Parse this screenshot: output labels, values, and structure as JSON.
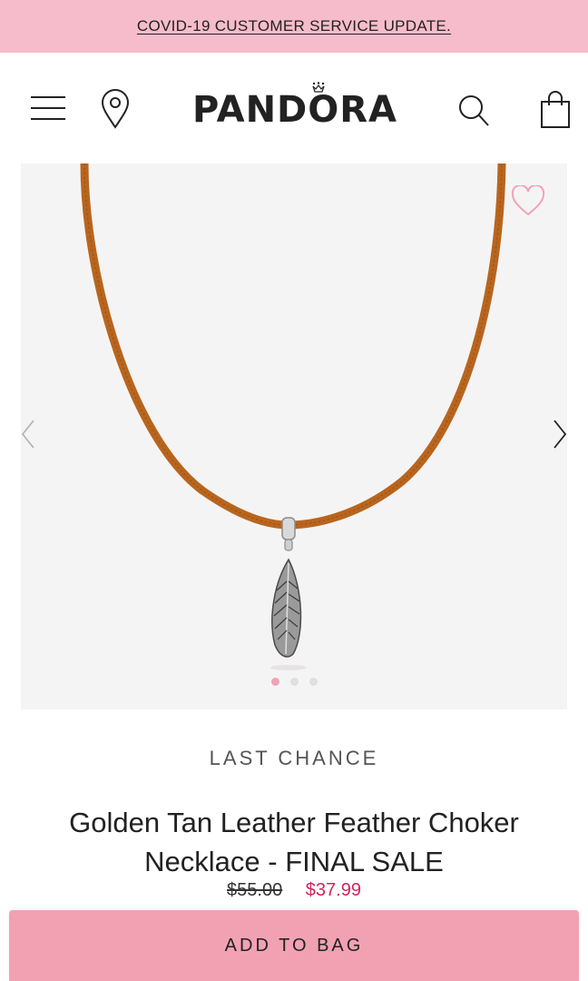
{
  "promo": {
    "text": "COVID-19 CUSTOMER SERVICE UPDATE."
  },
  "header": {
    "logo": "PANDORA",
    "icons": [
      "menu-icon",
      "location-pin-icon",
      "search-icon",
      "shopping-bag-icon"
    ]
  },
  "gallery": {
    "image_alt": "Golden Tan Leather Feather Choker Necklace",
    "slides_total": 3,
    "active_slide": 1,
    "wishlist_icon": "heart-outline-icon",
    "prev_icon": "chevron-left-icon",
    "next_icon": "chevron-right-icon"
  },
  "product": {
    "badge": "LAST CHANCE",
    "title": "Golden Tan Leather Feather Choker Necklace - FINAL SALE",
    "price_original": "$55.00",
    "price_sale": "$37.99"
  },
  "cta": {
    "add_to_bag": "ADD TO BAG"
  },
  "colors": {
    "promo_bg": "#f7bccb",
    "button_bg": "#f2a1b3",
    "sale_price": "#d4245c",
    "leather": "#b8651e"
  }
}
